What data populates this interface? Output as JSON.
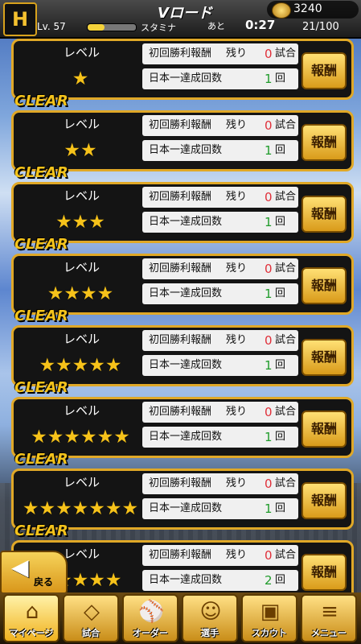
{
  "header": {
    "logo_text": "H",
    "title": "Vロード",
    "level": "Lv. 57",
    "stamina_label": "スタミナ",
    "remaining_label": "あと",
    "timer": "0:27",
    "coins": "3240",
    "stamina": "21/100",
    "exp_fraction": 0.35
  },
  "rows": [
    {
      "clear": "",
      "level_label": "レベル",
      "stars": "★",
      "reward1_label": "初回勝利報酬",
      "remain_label": "残り",
      "remain_count": "0",
      "remain_unit": "試合",
      "reward2_label": "日本一達成回数",
      "count": "1",
      "count_unit": "回",
      "button": "報酬"
    },
    {
      "clear": "CLEAR",
      "level_label": "レベル",
      "stars": "★★",
      "reward1_label": "初回勝利報酬",
      "remain_label": "残り",
      "remain_count": "0",
      "remain_unit": "試合",
      "reward2_label": "日本一達成回数",
      "count": "1",
      "count_unit": "回",
      "button": "報酬"
    },
    {
      "clear": "CLEAR",
      "level_label": "レベル",
      "stars": "★★★",
      "reward1_label": "初回勝利報酬",
      "remain_label": "残り",
      "remain_count": "0",
      "remain_unit": "試合",
      "reward2_label": "日本一達成回数",
      "count": "1",
      "count_unit": "回",
      "button": "報酬"
    },
    {
      "clear": "CLEAR",
      "level_label": "レベル",
      "stars": "★★★★",
      "reward1_label": "初回勝利報酬",
      "remain_label": "残り",
      "remain_count": "0",
      "remain_unit": "試合",
      "reward2_label": "日本一達成回数",
      "count": "1",
      "count_unit": "回",
      "button": "報酬"
    },
    {
      "clear": "CLEAR",
      "level_label": "レベル",
      "stars": "★★★★★",
      "reward1_label": "初回勝利報酬",
      "remain_label": "残り",
      "remain_count": "0",
      "remain_unit": "試合",
      "reward2_label": "日本一達成回数",
      "count": "1",
      "count_unit": "回",
      "button": "報酬"
    },
    {
      "clear": "CLEAR",
      "level_label": "レベル",
      "stars": "★★★★★★",
      "reward1_label": "初回勝利報酬",
      "remain_label": "残り",
      "remain_count": "0",
      "remain_unit": "試合",
      "reward2_label": "日本一達成回数",
      "count": "1",
      "count_unit": "回",
      "button": "報酬"
    },
    {
      "clear": "CLEAR",
      "level_label": "レベル",
      "stars": "★★★★★★★",
      "reward1_label": "初回勝利報酬",
      "remain_label": "残り",
      "remain_count": "0",
      "remain_unit": "試合",
      "reward2_label": "日本一達成回数",
      "count": "1",
      "count_unit": "回",
      "button": "報酬"
    },
    {
      "clear": "CLEAR",
      "level_label": "レベル",
      "stars": "★★★★★",
      "reward1_label": "初回勝利報酬",
      "remain_label": "残り",
      "remain_count": "0",
      "remain_unit": "試合",
      "reward2_label": "日本一達成回数",
      "count": "2",
      "count_unit": "回",
      "button": "報酬"
    }
  ],
  "back": {
    "label": "戻る"
  },
  "nav": [
    {
      "label": "マイページ",
      "icon": "home-icon"
    },
    {
      "label": "試合",
      "icon": "baseball-field-icon"
    },
    {
      "label": "オーダー",
      "icon": "lineup-icon"
    },
    {
      "label": "選手",
      "icon": "player-icon"
    },
    {
      "label": "スカウト",
      "icon": "scout-card-icon"
    },
    {
      "label": "メニュー",
      "icon": "menu-icon"
    }
  ]
}
